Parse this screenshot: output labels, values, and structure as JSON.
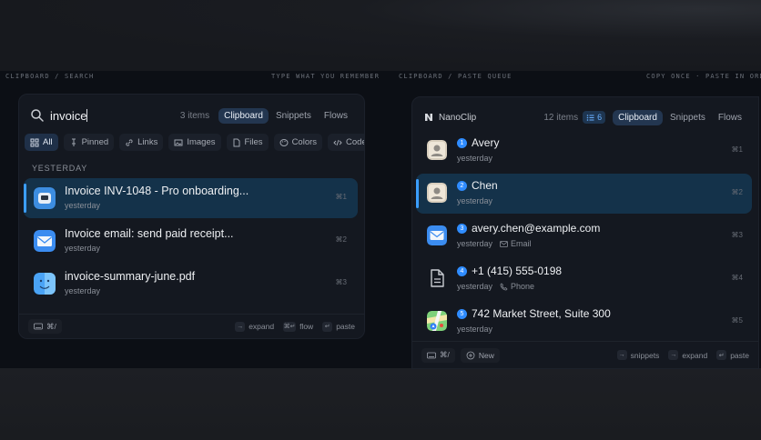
{
  "captions": {
    "left_title": "CLIPBOARD / SEARCH",
    "left_hint": "TYPE WHAT YOU REMEMBER",
    "right_title": "CLIPBOARD / PASTE QUEUE",
    "right_hint": "COPY ONCE · PASTE IN ORDE"
  },
  "search_panel": {
    "query": "invoice",
    "count": "3 items",
    "tabs": [
      "Clipboard",
      "Snippets",
      "Flows"
    ],
    "active_tab": "Clipboard",
    "filters": [
      {
        "label": "All",
        "icon": "grid-icon",
        "active": true
      },
      {
        "label": "Pinned",
        "icon": "pin-icon"
      },
      {
        "label": "Links",
        "icon": "link-icon"
      },
      {
        "label": "Images",
        "icon": "image-icon"
      },
      {
        "label": "Files",
        "icon": "file-icon"
      },
      {
        "label": "Colors",
        "icon": "palette-icon"
      },
      {
        "label": "Code",
        "icon": "code-icon"
      }
    ],
    "section": "YESTERDAY",
    "items": [
      {
        "title": "Invoice INV-1048 - Pro onboarding...",
        "sub": "yesterday",
        "kbd": "⌘1",
        "icon": "app-icon",
        "selected": true
      },
      {
        "title": "Invoice email: send paid receipt...",
        "sub": "yesterday",
        "kbd": "⌘2",
        "icon": "mail-icon"
      },
      {
        "title": "invoice-summary-june.pdf",
        "sub": "yesterday",
        "kbd": "⌘3",
        "icon": "finder-icon"
      }
    ],
    "footer": {
      "shortcut": "⌘/",
      "hints": [
        {
          "key": "→",
          "label": "expand"
        },
        {
          "key": "⌘↵",
          "label": "flow"
        },
        {
          "key": "↵",
          "label": "paste"
        }
      ]
    }
  },
  "queue_panel": {
    "brand": "NanoClip",
    "count": "12 items",
    "queue_count": "6",
    "tabs": [
      "Clipboard",
      "Snippets",
      "Flows"
    ],
    "active_tab": "Clipboard",
    "items": [
      {
        "num": "1",
        "title": "Avery",
        "sub": "yesterday",
        "meta": "",
        "kbd": "⌘1",
        "icon": "contact-icon"
      },
      {
        "num": "2",
        "title": "Chen",
        "sub": "yesterday",
        "meta": "",
        "kbd": "⌘2",
        "icon": "contact-icon",
        "selected": true
      },
      {
        "num": "3",
        "title": "avery.chen@example.com",
        "sub": "yesterday",
        "meta": "Email",
        "kbd": "⌘3",
        "icon": "mail-icon"
      },
      {
        "num": "4",
        "title": "+1 (415) 555-0198",
        "sub": "yesterday",
        "meta": "Phone",
        "kbd": "⌘4",
        "icon": "document-icon"
      },
      {
        "num": "5",
        "title": "742 Market Street, Suite 300",
        "sub": "yesterday",
        "meta": "",
        "kbd": "⌘5",
        "icon": "maps-icon"
      }
    ],
    "footer": {
      "shortcut": "⌘/",
      "new_label": "New",
      "hints": [
        {
          "key": "→",
          "label": "snippets"
        },
        {
          "key": "→",
          "label": "expand"
        },
        {
          "key": "↵",
          "label": "paste"
        }
      ]
    }
  }
}
